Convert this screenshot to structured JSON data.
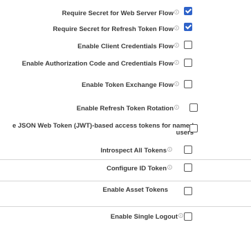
{
  "settings": [
    {
      "label": "Require Secret for Web Server Flow",
      "checked": true
    },
    {
      "label": "Require Secret for Refresh Token Flow",
      "checked": true
    },
    {
      "label": "Enable Client Credentials Flow",
      "checked": false
    },
    {
      "label": "Enable Authorization Code and Credentials Flow",
      "checked": false
    },
    {
      "label": "Enable Token Exchange Flow",
      "checked": false
    },
    {
      "label": "Enable Refresh Token Rotation",
      "checked": false
    },
    {
      "label": "e JSON Web Token (JWT)-based access tokens for named users",
      "checked": false
    },
    {
      "label": "Introspect All Tokens",
      "checked": false
    },
    {
      "label": "Configure ID Token",
      "checked": false
    },
    {
      "label": "Enable Asset Tokens",
      "checked": false
    },
    {
      "label": "Enable Single Logout",
      "checked": false
    }
  ],
  "colors": {
    "checked_fill": "#2f63c9",
    "label_text": "#3a3a3a",
    "divider": "#d6d6d6"
  }
}
